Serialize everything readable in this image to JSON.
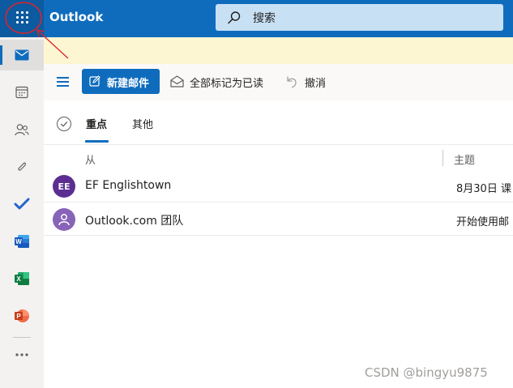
{
  "app": {
    "title": "Outlook",
    "search_placeholder": "搜索"
  },
  "rail": {
    "items": [
      {
        "name": "mail",
        "icon": "mail-icon"
      },
      {
        "name": "calendar",
        "icon": "calendar-icon"
      },
      {
        "name": "people",
        "icon": "people-icon"
      },
      {
        "name": "files",
        "icon": "paperclip-icon"
      },
      {
        "name": "todo",
        "icon": "todo-check-icon"
      },
      {
        "name": "word",
        "icon": "word-icon",
        "letter": "W"
      },
      {
        "name": "excel",
        "icon": "excel-icon",
        "letter": "X"
      },
      {
        "name": "powerpoint",
        "icon": "powerpoint-icon",
        "letter": "P"
      },
      {
        "name": "more-apps",
        "icon": "more-icon"
      }
    ]
  },
  "toolbar": {
    "new_mail_label": "新建邮件",
    "mark_all_read_label": "全部标记为已读",
    "undo_label": "撤消"
  },
  "tabs": [
    {
      "label": "重点",
      "active": true
    },
    {
      "label": "其他",
      "active": false
    }
  ],
  "columns": {
    "from": "从",
    "subject": "主题"
  },
  "messages": [
    {
      "avatar_initials": "EE",
      "avatar_color": "#5c2e91",
      "sender": "EF Englishtown",
      "subject": "8月30日 课"
    },
    {
      "avatar_initials": "",
      "avatar_color": "#8764b8",
      "sender": "Outlook.com 团队",
      "subject": "开始使用邮"
    }
  ],
  "watermark": "CSDN @bingyu9875",
  "colors": {
    "brand_blue": "#0f6cbd",
    "search_bg": "#c7e0f4",
    "banner_bg": "#fdf6d3",
    "annotation_red": "#e0232a"
  }
}
